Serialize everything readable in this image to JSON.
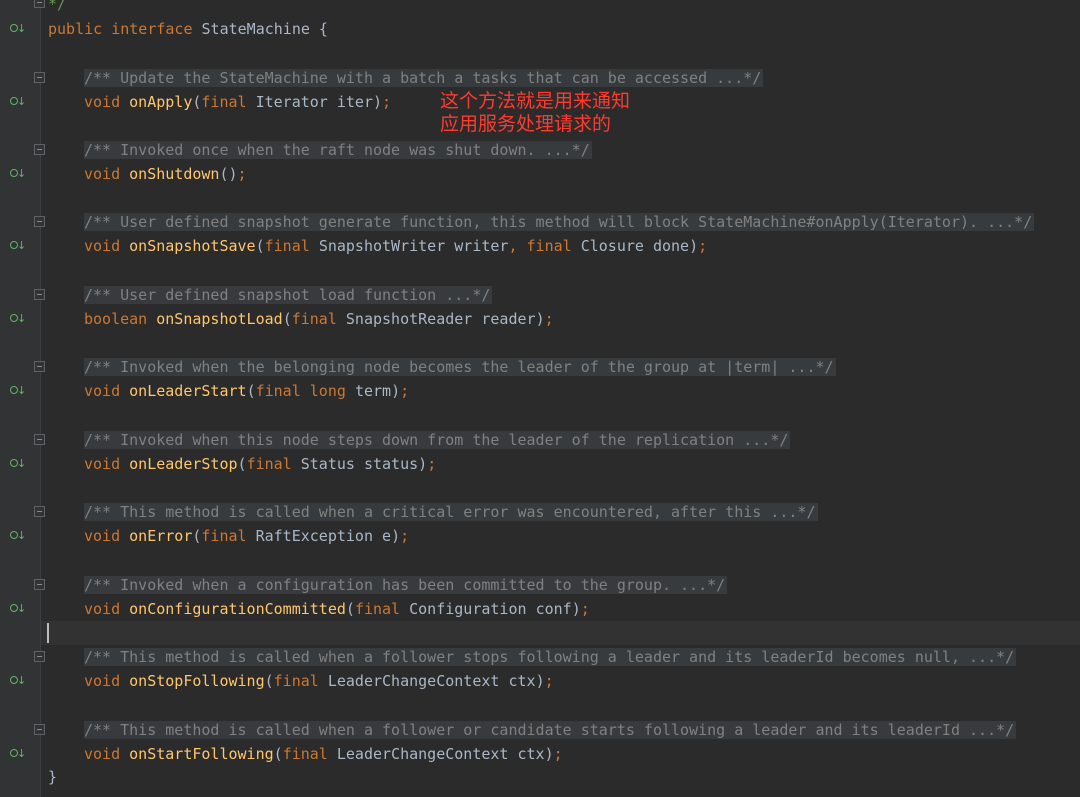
{
  "code": {
    "top_comment_end": "*/",
    "interface_decl": {
      "kw1": "public",
      "kw2": "interface",
      "name": "StateMachine",
      "brace": " {"
    },
    "methods": [
      {
        "doc": "/** Update the StateMachine with a batch a tasks that can be accessed ...*/",
        "ret": "void",
        "name": "onApply",
        "params": [
          {
            "kw": "final",
            "type": "Iterator",
            "name": "iter"
          }
        ]
      },
      {
        "doc": "/** Invoked once when the raft node was shut down. ...*/",
        "ret": "void",
        "name": "onShutdown",
        "params": []
      },
      {
        "doc": "/** User defined snapshot generate function, this method will block StateMachine#onApply(Iterator). ...*/",
        "ret": "void",
        "name": "onSnapshotSave",
        "params": [
          {
            "kw": "final",
            "type": "SnapshotWriter",
            "name": "writer"
          },
          {
            "kw": "final",
            "type": "Closure",
            "name": "done"
          }
        ]
      },
      {
        "doc": "/** User defined snapshot load function ...*/",
        "ret": "boolean",
        "name": "onSnapshotLoad",
        "params": [
          {
            "kw": "final",
            "type": "SnapshotReader",
            "name": "reader"
          }
        ]
      },
      {
        "doc": "/** Invoked when the belonging node becomes the leader of the group at |term| ...*/",
        "ret": "void",
        "name": "onLeaderStart",
        "params": [
          {
            "kw": "final long",
            "type": "",
            "name": "term"
          }
        ]
      },
      {
        "doc": "/** Invoked when this node steps down from the leader of the replication ...*/",
        "ret": "void",
        "name": "onLeaderStop",
        "params": [
          {
            "kw": "final",
            "type": "Status",
            "name": "status"
          }
        ]
      },
      {
        "doc": "/** This method is called when a critical error was encountered, after this ...*/",
        "ret": "void",
        "name": "onError",
        "params": [
          {
            "kw": "final",
            "type": "RaftException",
            "name": "e"
          }
        ]
      },
      {
        "doc": "/** Invoked when a configuration has been committed to the group. ...*/",
        "ret": "void",
        "name": "onConfigurationCommitted",
        "params": [
          {
            "kw": "final",
            "type": "Configuration",
            "name": "conf"
          }
        ]
      },
      {
        "doc": "/** This method is called when a follower stops following a leader and its leaderId becomes null, ...*/",
        "ret": "void",
        "name": "onStopFollowing",
        "params": [
          {
            "kw": "final",
            "type": "LeaderChangeContext",
            "name": "ctx"
          }
        ]
      },
      {
        "doc": "/** This method is called when a follower or candidate starts following a leader and its leaderId ...*/",
        "ret": "void",
        "name": "onStartFollowing",
        "params": [
          {
            "kw": "final",
            "type": "LeaderChangeContext",
            "name": "ctx"
          }
        ]
      }
    ],
    "closing_brace": "}"
  },
  "annotation": {
    "line1": "这个方法就是用来通知",
    "line2": "应用服务处理请求的"
  },
  "colors": {
    "background": "#2b2b2b",
    "keyword": "#cc7832",
    "method": "#ffc66d",
    "comment": "#808080",
    "text": "#a9b7c6",
    "annotation": "#ff3b30",
    "implement_icon": "#5fb85f"
  }
}
